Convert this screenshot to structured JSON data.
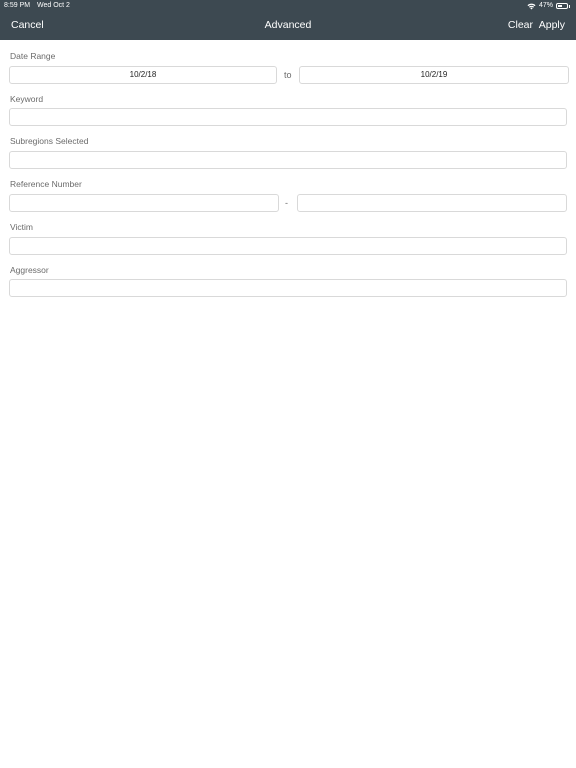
{
  "status_bar": {
    "time": "8:59 PM",
    "date": "Wed Oct 2",
    "battery_text": "47%",
    "battery_level": 0.47
  },
  "nav": {
    "cancel_label": "Cancel",
    "title": "Advanced",
    "clear_label": "Clear",
    "apply_label": "Apply"
  },
  "form": {
    "date_range": {
      "label": "Date Range",
      "from_value": "10/2/18",
      "separator": "to",
      "to_value": "10/2/19"
    },
    "keyword": {
      "label": "Keyword",
      "value": ""
    },
    "subregions": {
      "label": "Subregions Selected",
      "value": ""
    },
    "reference_number": {
      "label": "Reference Number",
      "from_value": "",
      "separator": "-",
      "to_value": ""
    },
    "victim": {
      "label": "Victim",
      "value": ""
    },
    "aggressor": {
      "label": "Aggressor",
      "value": ""
    }
  },
  "colors": {
    "nav_background": "#3d4951",
    "nav_text": "#ffffff",
    "field_border": "#d9d9d9",
    "label_text": "#6b6b6b"
  },
  "icons": [
    "wifi-icon",
    "battery-icon"
  ]
}
